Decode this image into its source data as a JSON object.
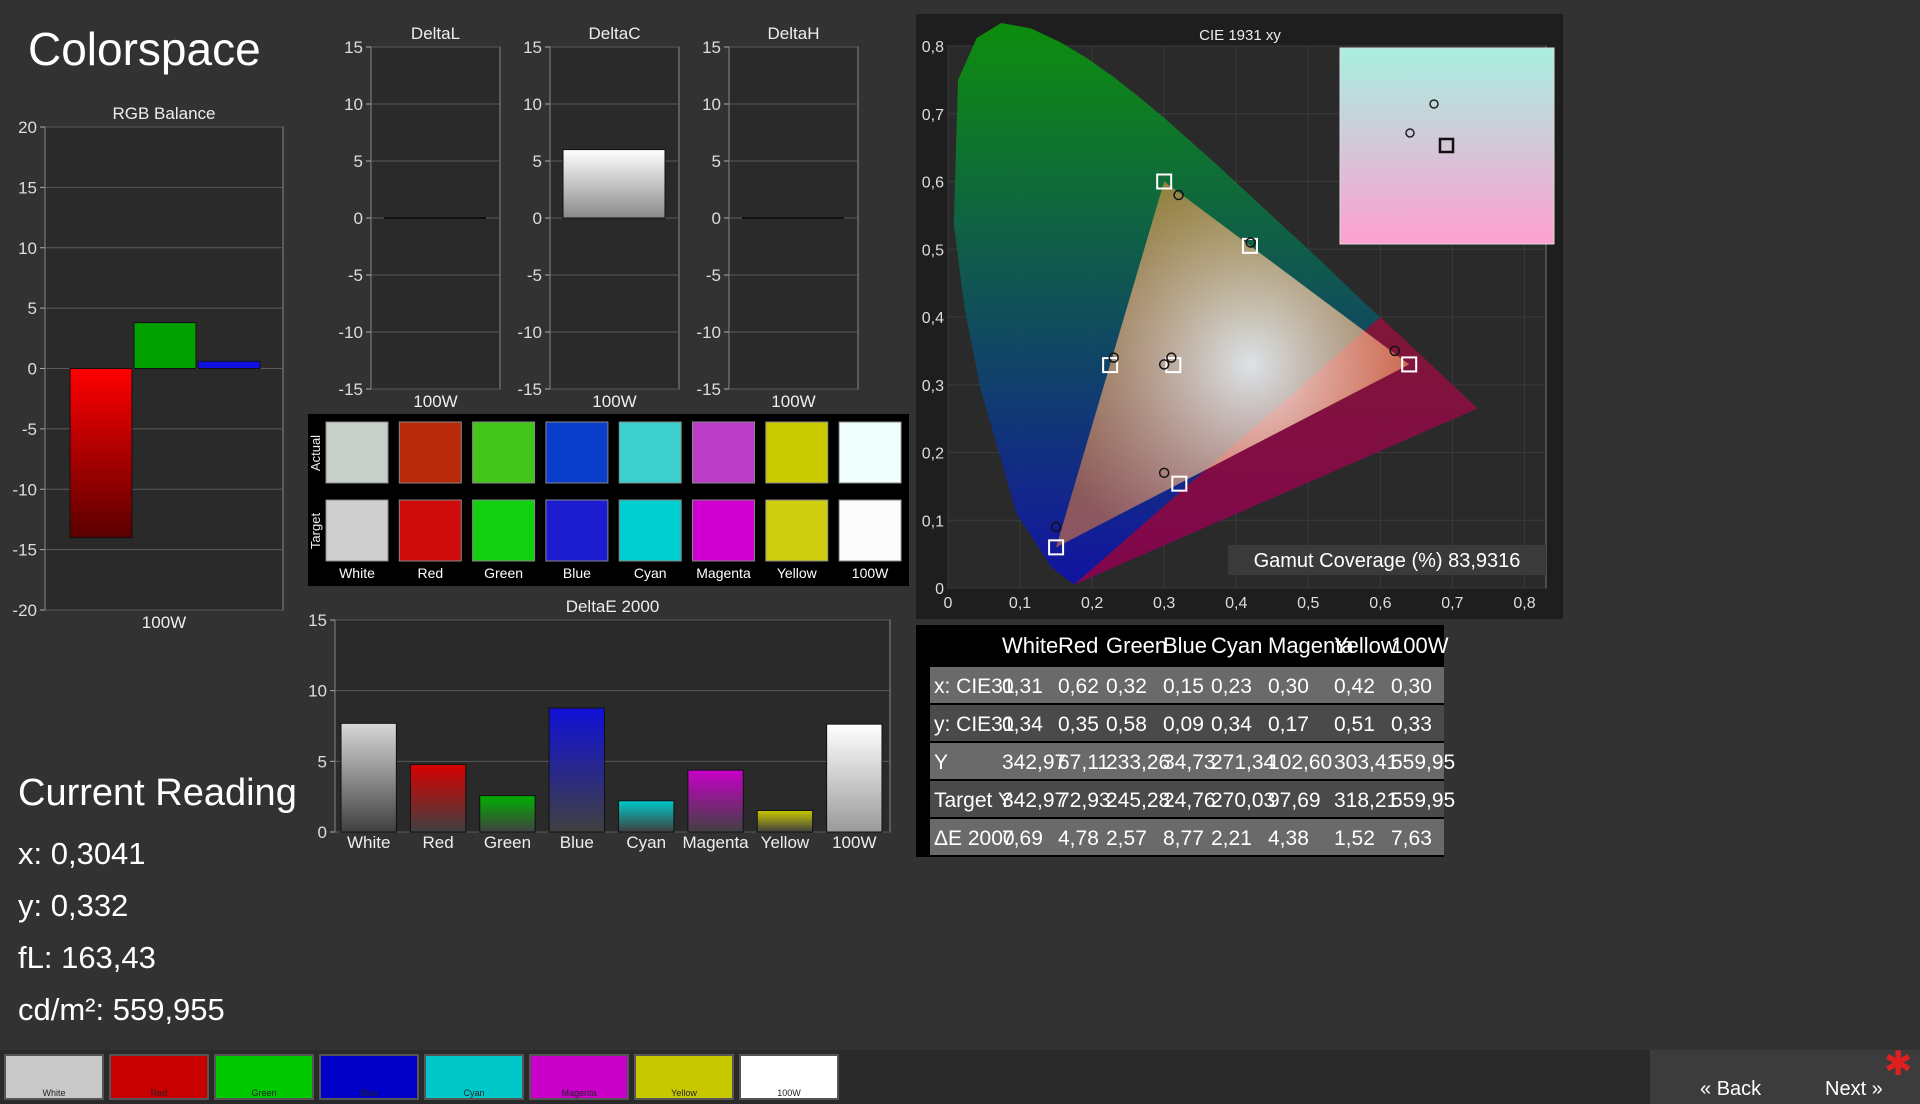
{
  "page_title": "Colorspace",
  "current_reading": {
    "title": "Current Reading",
    "x": "x: 0,3041",
    "y": "y: 0,332",
    "fl": "fL: 163,43",
    "cdm2": "cd/m²: 559,955"
  },
  "gamut_coverage": "Gamut Coverage (%) 83,9316",
  "patch_labels": [
    "White",
    "Red",
    "Green",
    "Blue",
    "Cyan",
    "Magenta",
    "Yellow",
    "100W"
  ],
  "swatch_row_labels": {
    "actual": "Actual",
    "target": "Target"
  },
  "actual_colors": [
    "#c6cfc8",
    "#b82a0a",
    "#44c51c",
    "#0a3ecb",
    "#3ccfcc",
    "#bb3cc7",
    "#c9ca00",
    "#f0fffd"
  ],
  "target_colors": [
    "#cfcfcf",
    "#cf0c0c",
    "#10d010",
    "#1b1dcf",
    "#00cfcf",
    "#cf00cf",
    "#cfcf10",
    "#fbfbfb"
  ],
  "bottom_swatches": [
    {
      "label": "White",
      "color": "#c9c9c9"
    },
    {
      "label": "Red",
      "color": "#c80000"
    },
    {
      "label": "Green",
      "color": "#00c800"
    },
    {
      "label": "Blue",
      "color": "#0000c8"
    },
    {
      "label": "Cyan",
      "color": "#00c8c8"
    },
    {
      "label": "Magenta",
      "color": "#c800c8"
    },
    {
      "label": "Yellow",
      "color": "#c8c800"
    },
    {
      "label": "100W",
      "color": "#ffffff"
    }
  ],
  "nav": {
    "back": "Back",
    "next": "Next"
  },
  "table": {
    "headers": [
      "",
      "White",
      "Red",
      "Green",
      "Blue",
      "Cyan",
      "Magenta",
      "Yellow",
      "100W"
    ],
    "rows": [
      [
        "x: CIE31",
        "0,31",
        "0,62",
        "0,32",
        "0,15",
        "0,23",
        "0,30",
        "0,42",
        "0,30"
      ],
      [
        "y: CIE31",
        "0,34",
        "0,35",
        "0,58",
        "0,09",
        "0,34",
        "0,17",
        "0,51",
        "0,33"
      ],
      [
        "Y",
        "342,97",
        "67,11",
        "233,26",
        "34,73",
        "271,34",
        "102,60",
        "303,41",
        "559,95"
      ],
      [
        "Target Y",
        "342,97",
        "72,93",
        "245,28",
        "24,76",
        "270,03",
        "97,69",
        "318,21",
        "559,95"
      ],
      [
        "ΔE 2000",
        "7,69",
        "4,78",
        "2,57",
        "8,77",
        "2,21",
        "4,38",
        "1,52",
        "7,63"
      ]
    ]
  },
  "chart_data": [
    {
      "type": "bar",
      "title": "RGB Balance",
      "categories": [
        "R",
        "G",
        "B"
      ],
      "values": [
        -14,
        3.8,
        0.6
      ],
      "colors": [
        "#ff0000",
        "#00a000",
        "#1010e0"
      ],
      "xlabel": "100W",
      "ylim": [
        -20,
        20
      ],
      "yticks": [
        -20,
        -15,
        -10,
        -5,
        0,
        5,
        10,
        15,
        20
      ]
    },
    {
      "type": "bar",
      "title": "DeltaL",
      "categories": [
        "100W"
      ],
      "values": [
        0
      ],
      "ylim": [
        -15,
        15
      ],
      "yticks": [
        -15,
        -10,
        -5,
        0,
        5,
        10,
        15
      ]
    },
    {
      "type": "bar",
      "title": "DeltaC",
      "categories": [
        "100W"
      ],
      "values": [
        6
      ],
      "ylim": [
        -15,
        15
      ],
      "yticks": [
        -15,
        -10,
        -5,
        0,
        5,
        10,
        15
      ]
    },
    {
      "type": "bar",
      "title": "DeltaH",
      "categories": [
        "100W"
      ],
      "values": [
        0
      ],
      "ylim": [
        -15,
        15
      ],
      "yticks": [
        -15,
        -10,
        -5,
        0,
        5,
        10,
        15
      ]
    },
    {
      "type": "bar",
      "title": "DeltaE 2000",
      "categories": [
        "White",
        "Red",
        "Green",
        "Blue",
        "Cyan",
        "Magenta",
        "Yellow",
        "100W"
      ],
      "values": [
        7.69,
        4.78,
        2.57,
        8.77,
        2.21,
        4.38,
        1.52,
        7.63
      ],
      "colors": [
        "#d8d8d8",
        "#d80000",
        "#00b000",
        "#1010d8",
        "#00c8c8",
        "#c800c8",
        "#c8c800",
        "#ffffff"
      ],
      "ylim": [
        0,
        15
      ],
      "yticks": [
        0,
        5,
        10,
        15
      ]
    },
    {
      "type": "scatter",
      "title": "CIE 1931 xy",
      "xlim": [
        0,
        0.8
      ],
      "ylim": [
        0,
        0.8
      ],
      "xticks": [
        "0",
        "0,1",
        "0,2",
        "0,3",
        "0,4",
        "0,5",
        "0,6",
        "0,7",
        "0,8"
      ],
      "yticks": [
        "0",
        "0,1",
        "0,2",
        "0,3",
        "0,4",
        "0,5",
        "0,6",
        "0,7",
        "0,8"
      ],
      "target_gamut": [
        [
          0.64,
          0.33
        ],
        [
          0.3,
          0.6
        ],
        [
          0.15,
          0.06
        ]
      ],
      "target_points": [
        [
          0.3127,
          0.329
        ],
        [
          0.64,
          0.33
        ],
        [
          0.3,
          0.6
        ],
        [
          0.15,
          0.06
        ],
        [
          0.225,
          0.329
        ],
        [
          0.321,
          0.154
        ],
        [
          0.419,
          0.505
        ]
      ],
      "measured_points": [
        [
          0.31,
          0.34
        ],
        [
          0.62,
          0.35
        ],
        [
          0.32,
          0.58
        ],
        [
          0.15,
          0.09
        ],
        [
          0.23,
          0.34
        ],
        [
          0.3,
          0.17
        ],
        [
          0.42,
          0.51
        ],
        [
          0.3,
          0.33
        ]
      ]
    }
  ]
}
